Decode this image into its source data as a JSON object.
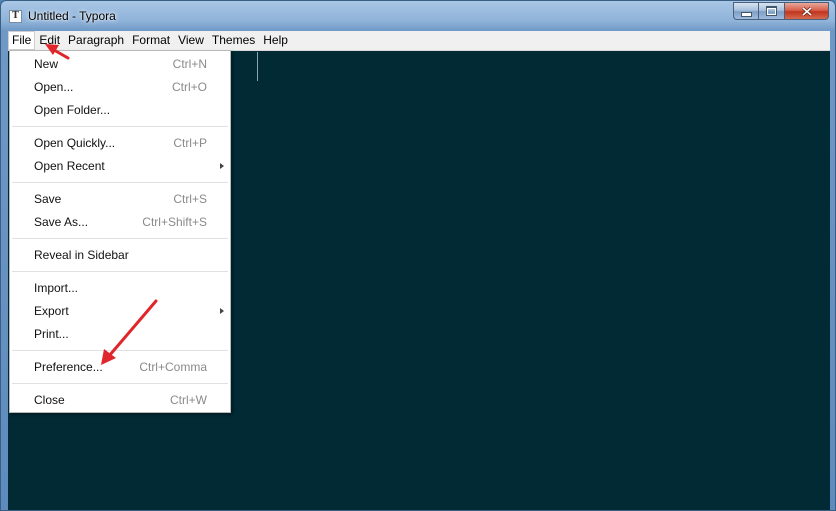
{
  "window": {
    "title": "Untitled - Typora",
    "app_icon_letter": "T"
  },
  "menubar": {
    "items": [
      {
        "label": "File"
      },
      {
        "label": "Edit"
      },
      {
        "label": "Paragraph"
      },
      {
        "label": "Format"
      },
      {
        "label": "View"
      },
      {
        "label": "Themes"
      },
      {
        "label": "Help"
      }
    ]
  },
  "file_menu": {
    "items": [
      {
        "label": "New",
        "shortcut": "Ctrl+N"
      },
      {
        "label": "Open...",
        "shortcut": "Ctrl+O"
      },
      {
        "label": "Open Folder...",
        "shortcut": ""
      },
      {
        "label": "Open Quickly...",
        "shortcut": "Ctrl+P"
      },
      {
        "label": "Open Recent",
        "shortcut": "",
        "submenu": true
      },
      {
        "label": "Save",
        "shortcut": "Ctrl+S"
      },
      {
        "label": "Save As...",
        "shortcut": "Ctrl+Shift+S"
      },
      {
        "label": "Reveal in Sidebar",
        "shortcut": ""
      },
      {
        "label": "Import...",
        "shortcut": ""
      },
      {
        "label": "Export",
        "shortcut": "",
        "submenu": true
      },
      {
        "label": "Print...",
        "shortcut": ""
      },
      {
        "label": "Preference...",
        "shortcut": "Ctrl+Comma"
      },
      {
        "label": "Close",
        "shortcut": "Ctrl+W"
      }
    ]
  },
  "colors": {
    "editor_background": "#012a35",
    "annotation_arrow": "#e0262b",
    "menu_background": "#ffffff",
    "menubar_background": "#f0f0f0"
  },
  "icons": {
    "minimize": "minimize-icon",
    "maximize": "maximize-icon",
    "close": "close-icon",
    "submenu": "chevron-right-icon"
  }
}
